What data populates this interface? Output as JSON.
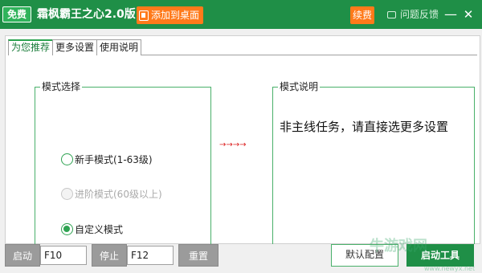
{
  "titlebar": {
    "free_badge": "免费",
    "title": "霜枫霸王之心2.0版",
    "add_desktop": "添加到桌面",
    "renew": "续费",
    "feedback": "问题反馈",
    "minimize": "—",
    "close": "✕"
  },
  "tabs": [
    {
      "label": "为您推荐",
      "active": true
    },
    {
      "label": "更多设置",
      "active": false
    },
    {
      "label": "使用说明",
      "active": false
    }
  ],
  "mode_group": {
    "legend": "模式选择",
    "options": [
      {
        "label": "新手模式(1-63级)",
        "checked": false,
        "disabled": false
      },
      {
        "label": "进阶模式(60级以上)",
        "checked": false,
        "disabled": true
      },
      {
        "label": "自定义模式",
        "checked": true,
        "disabled": false
      }
    ]
  },
  "desc_group": {
    "legend": "模式说明",
    "text": "非主线任务，请直接选更多设置"
  },
  "arrow_indicator": "→→→→",
  "bottom": {
    "start_label": "启动",
    "start_key": "F10",
    "stop_label": "停止",
    "stop_key": "F12",
    "reset_label": "重置",
    "default_config": "默认配置",
    "launch_tool": "启动工具"
  },
  "watermark": "牛游戏网",
  "watermark_sub": "www.newyx.net"
}
